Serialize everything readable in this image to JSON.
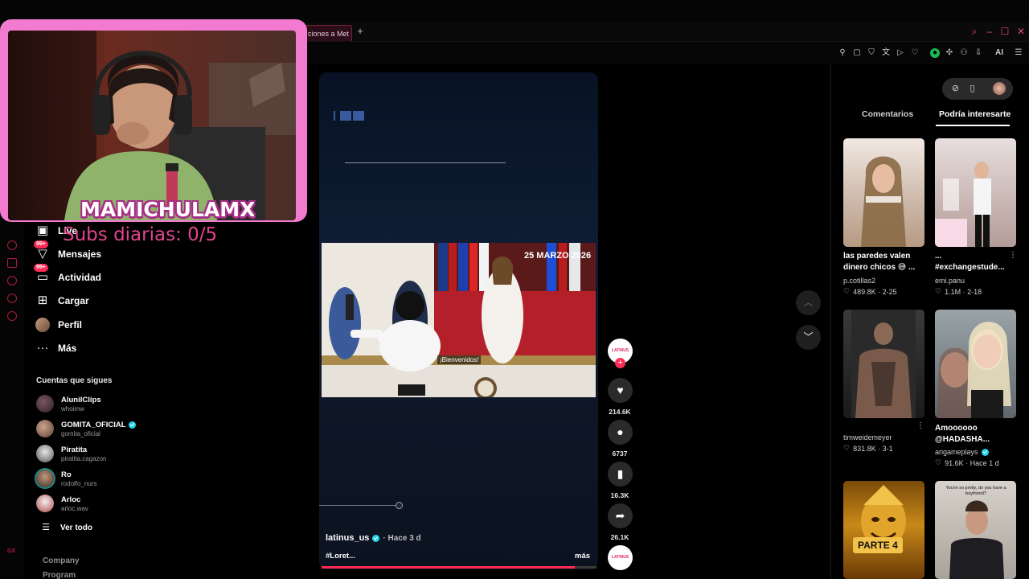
{
  "browser": {
    "tab_title": "ciones a Met",
    "new_tab": "+",
    "gx_label": "GX",
    "toolbar_ai": "AI"
  },
  "overlay": {
    "streamer_name": "MAMICHULAMX",
    "subs_text": "Subs diarias: 0/5"
  },
  "nav": {
    "items": [
      {
        "label": "Live",
        "icon": "live-icon"
      },
      {
        "label": "Mensajes",
        "icon": "messages-icon",
        "badge": "99+"
      },
      {
        "label": "Actividad",
        "icon": "activity-icon",
        "badge": "99+"
      },
      {
        "label": "Cargar",
        "icon": "upload-icon"
      },
      {
        "label": "Perfil",
        "icon": "profile-avatar"
      },
      {
        "label": "Más",
        "icon": "more-icon"
      }
    ],
    "following_title": "Cuentas que sigues",
    "following": [
      {
        "name": "AlunilClips",
        "user": "whoimw"
      },
      {
        "name": "GOMITA_OFICIAL",
        "user": "gomita_oficial",
        "verified": true
      },
      {
        "name": "Piratita",
        "user": "piratita.cagazon"
      },
      {
        "name": "Ro",
        "user": "rodolfo_nurs"
      },
      {
        "name": "Arloc",
        "user": "arloc.wav"
      }
    ],
    "see_all": "Ver todo",
    "footer": [
      "Company",
      "Program"
    ]
  },
  "video": {
    "date_badge": "25 MARZO 2026",
    "subtitle": "¡Bienvenidos!",
    "author": "latinus_us",
    "time": "· Hace 3 d",
    "description": "#Loret...",
    "more": "más",
    "progress": 0.92,
    "avatar_label": "LATINUS"
  },
  "actions": {
    "likes": "214.6K",
    "comments": "6737",
    "saves": "16.3K",
    "shares": "26.1K"
  },
  "right": {
    "tab_comments": "Comentarios",
    "tab_interest": "Podría interesarte",
    "videos": [
      {
        "title": "las paredes valen dinero chicos 😅 ...",
        "user": "p.cotillas2",
        "stats": "489.8K · 2-25"
      },
      {
        "title": "... #exchangestude...",
        "user": "emi.panu",
        "stats": "1.1M · 2-18"
      },
      {
        "title": "",
        "user": "timweidemeyer",
        "stats": "831.8K · 3-1"
      },
      {
        "title": "Amoooooo @HADASHA...",
        "user": "arigameplays",
        "stats": "91.6K · Hace 1 d",
        "verified": true
      },
      {
        "title": "",
        "user": "",
        "stats": "",
        "overlay": "PARTE 4"
      },
      {
        "title": "",
        "user": "",
        "stats": "",
        "overlay": "You're so pretty, do you have a boyfriend?"
      }
    ]
  },
  "colors": {
    "accent": "#fe2c55",
    "gx_red": "#b01c3c",
    "cam_border": "#f27ad0",
    "verified": "#20d5ec"
  }
}
